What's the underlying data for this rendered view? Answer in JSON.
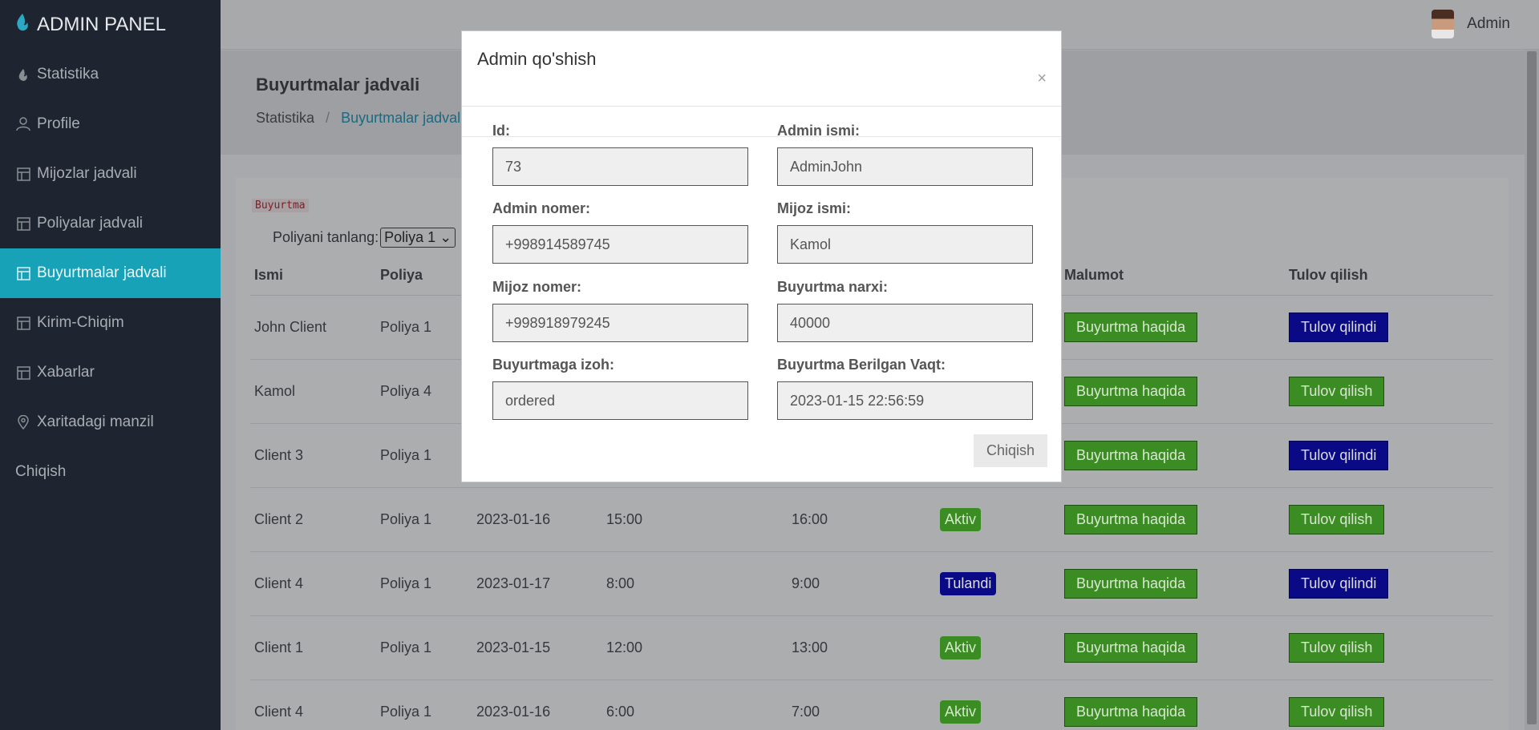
{
  "sidebar": {
    "brand": "ADMIN PANEL",
    "items": [
      {
        "label": "Statistika",
        "icon": "flame-icon"
      },
      {
        "label": "Profile",
        "icon": "user-icon"
      },
      {
        "label": "Mijozlar jadvali",
        "icon": "table-icon"
      },
      {
        "label": "Poliyalar jadvali",
        "icon": "table-icon"
      },
      {
        "label": "Buyurtmalar jadvali",
        "icon": "table-icon",
        "active": true
      },
      {
        "label": "Kirim-Chiqim",
        "icon": "table-icon"
      },
      {
        "label": "Xabarlar",
        "icon": "table-icon"
      },
      {
        "label": "Xaritadagi manzil",
        "icon": "map-pin-icon"
      },
      {
        "label": "Chiqish",
        "icon": ""
      }
    ]
  },
  "topbar": {
    "user_name": "Admin"
  },
  "page": {
    "title": "Buyurtmalar jadvali",
    "breadcrumb": {
      "home": "Statistika",
      "separator": "/",
      "current": "Buyurtmalar jadvali"
    }
  },
  "card": {
    "badge": "Buyurtma",
    "select_label": "Poliyani tanlang:",
    "select_value": "Poliya 1"
  },
  "table": {
    "headers": [
      "Ismi",
      "Poliya",
      "",
      "",
      "",
      "",
      "Malumot",
      "Tulov qilish"
    ],
    "rows": [
      {
        "name": "John Client",
        "poliya": "Poliya 1",
        "date": "",
        "start": "",
        "end": "",
        "status": "",
        "status_type": "",
        "info": "Buyurtma haqida",
        "pay": "Tulov qilindi",
        "pay_type": "blue"
      },
      {
        "name": "Kamol",
        "poliya": "Poliya 4",
        "date": "",
        "start": "",
        "end": "",
        "status": "",
        "status_type": "",
        "info": "Buyurtma haqida",
        "pay": "Tulov qilish",
        "pay_type": "green"
      },
      {
        "name": "Client 3",
        "poliya": "Poliya 1",
        "date": "",
        "start": "",
        "end": "",
        "status": "",
        "status_type": "",
        "info": "Buyurtma haqida",
        "pay": "Tulov qilindi",
        "pay_type": "blue"
      },
      {
        "name": "Client 2",
        "poliya": "Poliya 1",
        "date": "2023-01-16",
        "start": "15:00",
        "end": "16:00",
        "status": "Aktiv",
        "status_type": "green",
        "info": "Buyurtma haqida",
        "pay": "Tulov qilish",
        "pay_type": "green"
      },
      {
        "name": "Client 4",
        "poliya": "Poliya 1",
        "date": "2023-01-17",
        "start": "8:00",
        "end": "9:00",
        "status": "Tulandi",
        "status_type": "blue",
        "info": "Buyurtma haqida",
        "pay": "Tulov qilindi",
        "pay_type": "blue"
      },
      {
        "name": "Client 1",
        "poliya": "Poliya 1",
        "date": "2023-01-15",
        "start": "12:00",
        "end": "13:00",
        "status": "Aktiv",
        "status_type": "green",
        "info": "Buyurtma haqida",
        "pay": "Tulov qilish",
        "pay_type": "green"
      },
      {
        "name": "Client 4",
        "poliya": "Poliya 1",
        "date": "2023-01-16",
        "start": "6:00",
        "end": "7:00",
        "status": "Aktiv",
        "status_type": "green",
        "info": "Buyurtma haqida",
        "pay": "Tulov qilish",
        "pay_type": "green"
      }
    ]
  },
  "modal": {
    "title": "Admin qo'shish",
    "close": "×",
    "fields": {
      "id": {
        "label": "Id:",
        "value": "73"
      },
      "admin_name": {
        "label": "Admin ismi:",
        "value": "AdminJohn"
      },
      "admin_phone": {
        "label": "Admin nomer:",
        "value": "+998914589745"
      },
      "client_name": {
        "label": "Mijoz ismi:",
        "value": "Kamol"
      },
      "client_phone": {
        "label": "Mijoz nomer:",
        "value": "+998918979245"
      },
      "order_price": {
        "label": "Buyurtma narxi:",
        "value": "40000"
      },
      "order_note": {
        "label": "Buyurtmaga izoh:",
        "value": "ordered"
      },
      "order_time": {
        "label": "Buyurtma Berilgan Vaqt:",
        "value": "2023-01-15 22:56:59"
      }
    },
    "exit_label": "Chiqish"
  },
  "colors": {
    "accent": "#17a2b8",
    "sidebar": "#1f2530",
    "green": "#3a8c23",
    "blue": "#0a0a86"
  }
}
